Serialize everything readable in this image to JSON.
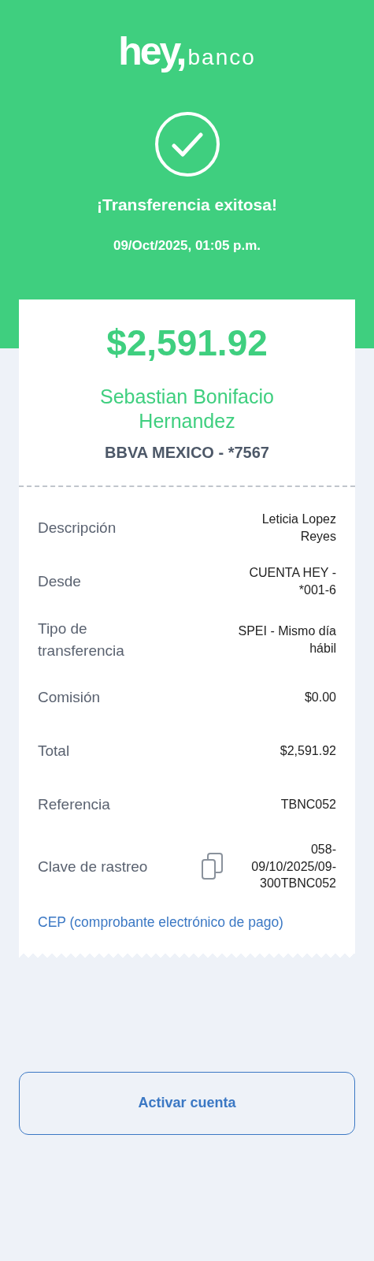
{
  "brand": {
    "wordmark": "hey,",
    "name": "banco"
  },
  "status": {
    "title": "¡Transferencia exitosa!",
    "datetime": "09/Oct/2025, 01:05 p.m."
  },
  "receipt": {
    "amount": "$2,591.92",
    "recipient": "Sebastian Bonifacio Hernandez",
    "bank": "BBVA MEXICO - *7567",
    "details": [
      {
        "label": "Descripción",
        "value": "Leticia Lopez Reyes",
        "copyable": false
      },
      {
        "label": "Desde",
        "value": "CUENTA HEY - *001-6",
        "copyable": false
      },
      {
        "label": "Tipo de transferencia",
        "value": "SPEI - Mismo día hábil",
        "copyable": false
      },
      {
        "label": "Comisión",
        "value": "$0.00",
        "copyable": false
      },
      {
        "label": "Total",
        "value": "$2,591.92",
        "copyable": false
      },
      {
        "label": "Referencia",
        "value": "TBNC052",
        "copyable": false
      },
      {
        "label": "Clave de rastreo",
        "value": "058-09/10/2025/09-300TBNC052",
        "copyable": true
      }
    ],
    "link": "CEP (comprobante electrónico de pago)"
  },
  "button": "Activar cuenta"
}
